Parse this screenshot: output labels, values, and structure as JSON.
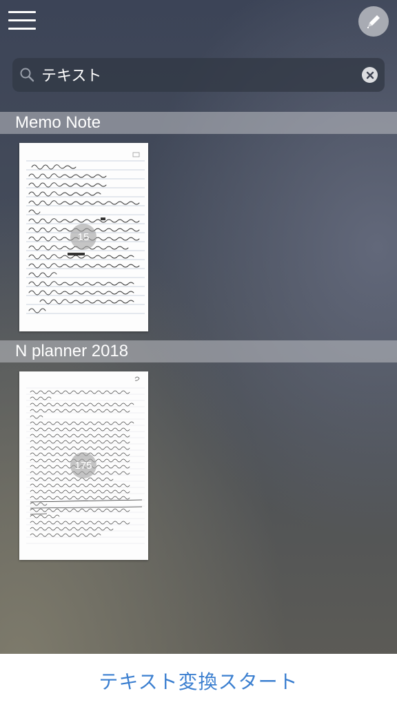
{
  "search": {
    "query": "テキスト"
  },
  "sections": [
    {
      "title": "Memo Note",
      "page_count": "15"
    },
    {
      "title": "N planner 2018",
      "page_count": "175"
    }
  ],
  "bottom": {
    "action_label": "テキスト変換スタート"
  },
  "colors": {
    "accent": "#3b7fd0",
    "section_bar": "#bec0c4",
    "pen_button": "#a8abb3"
  },
  "icons": [
    "menu-icon",
    "pen-icon",
    "search-icon",
    "clear-icon"
  ]
}
